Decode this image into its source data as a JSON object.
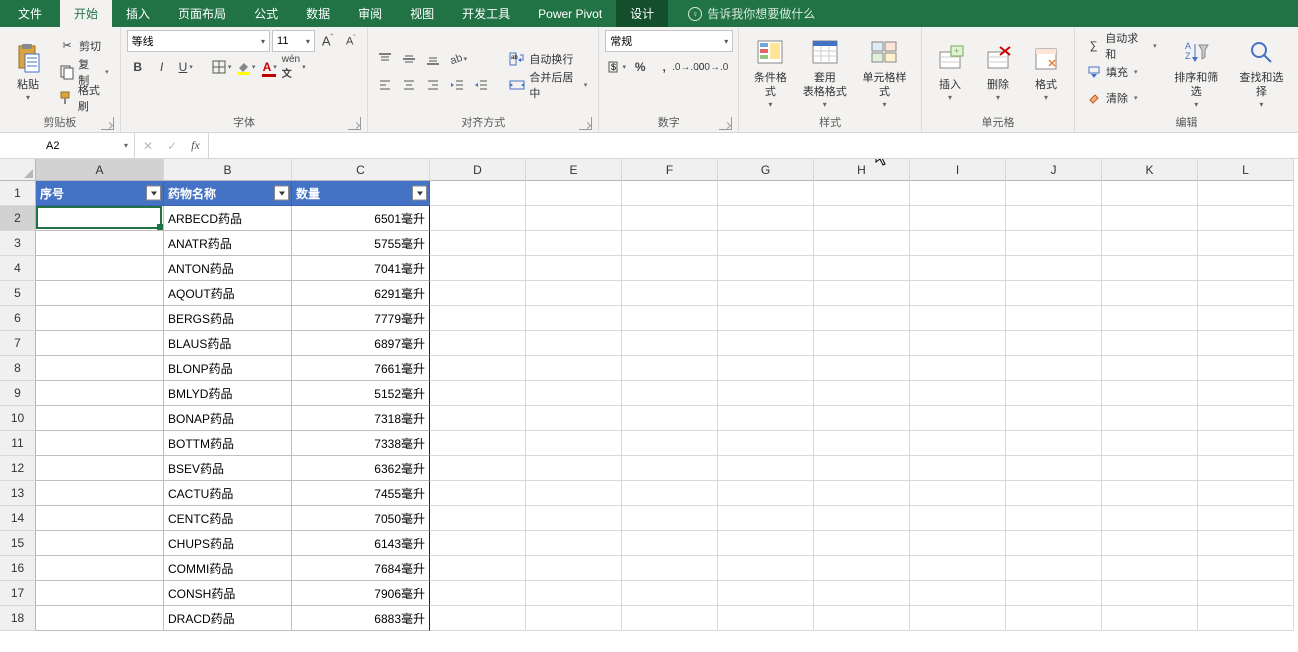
{
  "tabs": {
    "file": "文件",
    "home": "开始",
    "insert": "插入",
    "layout": "页面布局",
    "formulas": "公式",
    "data": "数据",
    "review": "审阅",
    "view": "视图",
    "dev": "开发工具",
    "powerpivot": "Power Pivot",
    "design": "设计"
  },
  "tellme": "告诉我你想要做什么",
  "clipboard": {
    "label": "剪贴板",
    "paste": "粘贴",
    "cut": "剪切",
    "copy": "复制",
    "painter": "格式刷"
  },
  "font": {
    "label": "字体",
    "name": "等线",
    "size": "11"
  },
  "align": {
    "label": "对齐方式",
    "wrap": "自动换行",
    "merge": "合并后居中"
  },
  "number": {
    "label": "数字",
    "format": "常规"
  },
  "styles": {
    "label": "样式",
    "cond": "条件格式",
    "table": "套用\n表格格式",
    "cell": "单元格样式"
  },
  "cells": {
    "label": "单元格",
    "insert": "插入",
    "delete": "删除",
    "format": "格式"
  },
  "editing": {
    "label": "编辑",
    "sum": "自动求和",
    "fill": "填充",
    "clear": "清除",
    "sort": "排序和筛选",
    "find": "查找和选择"
  },
  "namebox": "A2",
  "columns": [
    "A",
    "B",
    "C",
    "D",
    "E",
    "F",
    "G",
    "H",
    "I",
    "J",
    "K",
    "L"
  ],
  "headers": {
    "col1": "序号",
    "col2": "药物名称",
    "col3": "数量"
  },
  "chart_data": {
    "type": "table",
    "columns": [
      "序号",
      "药物名称",
      "数量"
    ],
    "rows": [
      {
        "name": "ARBECD药品",
        "qty": "6501毫升"
      },
      {
        "name": "ANATR药品",
        "qty": "5755毫升"
      },
      {
        "name": "ANTON药品",
        "qty": "7041毫升"
      },
      {
        "name": "AQOUT药品",
        "qty": "6291毫升"
      },
      {
        "name": "BERGS药品",
        "qty": "7779毫升"
      },
      {
        "name": "BLAUS药品",
        "qty": "6897毫升"
      },
      {
        "name": "BLONP药品",
        "qty": "7661毫升"
      },
      {
        "name": "BMLYD药品",
        "qty": "5152毫升"
      },
      {
        "name": "BONAP药品",
        "qty": "7318毫升"
      },
      {
        "name": "BOTTM药品",
        "qty": "7338毫升"
      },
      {
        "name": "BSEV药品",
        "qty": "6362毫升"
      },
      {
        "name": "CACTU药品",
        "qty": "7455毫升"
      },
      {
        "name": "CENTC药品",
        "qty": "7050毫升"
      },
      {
        "name": "CHUPS药品",
        "qty": "6143毫升"
      },
      {
        "name": "COMMI药品",
        "qty": "7684毫升"
      },
      {
        "name": "CONSH药品",
        "qty": "7906毫升"
      },
      {
        "name": "DRACD药品",
        "qty": "6883毫升"
      }
    ]
  }
}
